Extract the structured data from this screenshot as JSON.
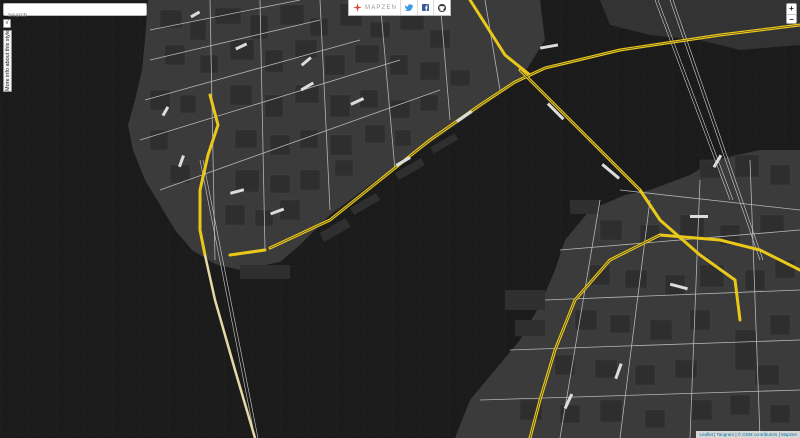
{
  "search": {
    "placeholder": "Search"
  },
  "side_toggle_label": "√",
  "info_tab_label": "More info about this style",
  "brand": {
    "name": "MAPZEN"
  },
  "social": {
    "twitter_icon": "twitter-icon",
    "facebook_icon": "facebook-icon",
    "github_icon": "github-icon"
  },
  "zoom": {
    "in_label": "+",
    "out_label": "−"
  },
  "attribution": {
    "leaflet": "Leaflet",
    "tangram": "Tangram",
    "osm": "© OSM contributors",
    "mapzen": "Mapzen",
    "separator": " | "
  },
  "colors": {
    "background": "#1b1b1b",
    "land": "#3c3c3c",
    "highway": "#e9c81a",
    "road": "#c9c9c9",
    "water": "#1b1b1b",
    "brand_accent": "#d64a3a"
  }
}
